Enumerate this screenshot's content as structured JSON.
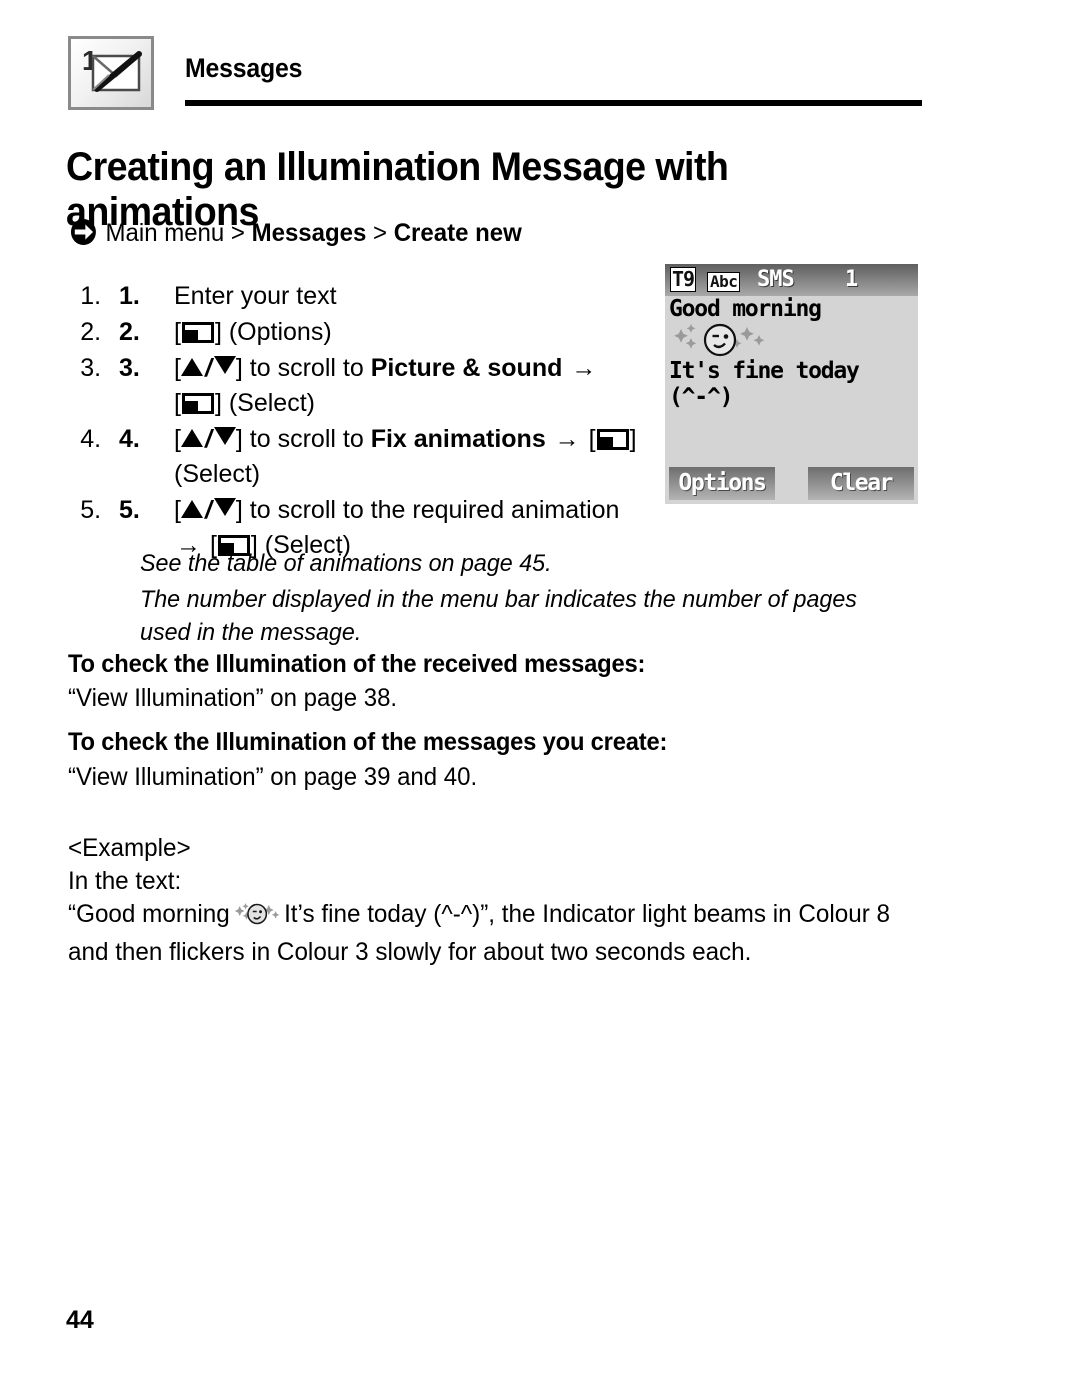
{
  "header": {
    "icon_name": "messages-envelope-icon",
    "title": "Messages"
  },
  "doc": {
    "title": "Creating an Illumination Message with animations",
    "page_number": "44"
  },
  "breadcrumb": {
    "arrow_icon": "arrow-right-circle-icon",
    "prefix": "Main menu > ",
    "bold_1": "Messages",
    "separator": " > ",
    "bold_2": "Create new"
  },
  "steps": [
    {
      "number": "1.",
      "segments": [
        {
          "type": "text",
          "value": "Enter your text"
        }
      ]
    },
    {
      "number": "2.",
      "segments": [
        {
          "type": "bracket_key",
          "value": "softkey-icon"
        },
        {
          "type": "text",
          "value": " (Options)"
        }
      ]
    },
    {
      "number": "3.",
      "segments": [
        {
          "type": "bracket_updown",
          "value": "up-down-scroll-icon"
        },
        {
          "type": "text",
          "value": " to scroll to "
        },
        {
          "type": "bold",
          "value": "Picture & sound"
        },
        {
          "type": "arrow",
          "value": "→"
        },
        {
          "type": "break",
          "value": ""
        },
        {
          "type": "bracket_key",
          "value": "softkey-icon"
        },
        {
          "type": "text",
          "value": " (Select)"
        }
      ]
    },
    {
      "number": "4.",
      "segments": [
        {
          "type": "bracket_updown",
          "value": "up-down-scroll-icon"
        },
        {
          "type": "text",
          "value": " to scroll to "
        },
        {
          "type": "bold",
          "value": "Fix animations"
        },
        {
          "type": "arrow",
          "value": "→"
        },
        {
          "type": "bracket_key",
          "value": "softkey-icon"
        },
        {
          "type": "break",
          "value": ""
        },
        {
          "type": "text",
          "value": "(Select)"
        }
      ]
    },
    {
      "number": "5.",
      "segments": [
        {
          "type": "bracket_updown",
          "value": "up-down-scroll-icon"
        },
        {
          "type": "text",
          "value": " to scroll to the required animation"
        },
        {
          "type": "break",
          "value": ""
        },
        {
          "type": "arrow",
          "value": "→"
        },
        {
          "type": "bracket_key",
          "value": "softkey-icon"
        },
        {
          "type": "text",
          "value": " (Select)"
        }
      ]
    }
  ],
  "notes": {
    "note_1": "See the table of animations on page 45.",
    "note_2": "The number displayed in the menu bar indicates the number of pages used in the message."
  },
  "sections": [
    {
      "heading": "To check the Illumination of the received messages:",
      "reference": "“View Illumination” on page 38."
    },
    {
      "heading": "To check the Illumination of the messages you create:",
      "reference": "“View Illumination” on page 39 and 40."
    }
  ],
  "example": {
    "label": "<Example>",
    "intro": "In the text:",
    "quote_before": "“Good morning",
    "smiley_icon": "sparkle-wink-smiley-icon",
    "quote_after": "It’s fine today (^-^)”, the Indicator light beams in Colour 8 and then flickers in Colour 3 slowly for about two seconds each."
  },
  "phone_screen": {
    "status": {
      "t9": "T9",
      "abc": "Abc",
      "mode": "SMS",
      "page_count": "1"
    },
    "body": {
      "line_1": "Good morning",
      "animation_icon": "sparkle-wink-smiley-icon",
      "line_2": "It's fine today",
      "line_3": "(^-^)"
    },
    "softkeys": {
      "left": "Options",
      "right": "Clear"
    }
  },
  "colors": {
    "ink": "#000000",
    "paper": "#ffffff",
    "screen_bg": "#d4d4d4",
    "statusbar_dark": "#5f5f5f",
    "statusbar_light": "#a9a9a9",
    "softkey_dark": "#6e6e6e",
    "softkey_light": "#b4b4b4"
  }
}
